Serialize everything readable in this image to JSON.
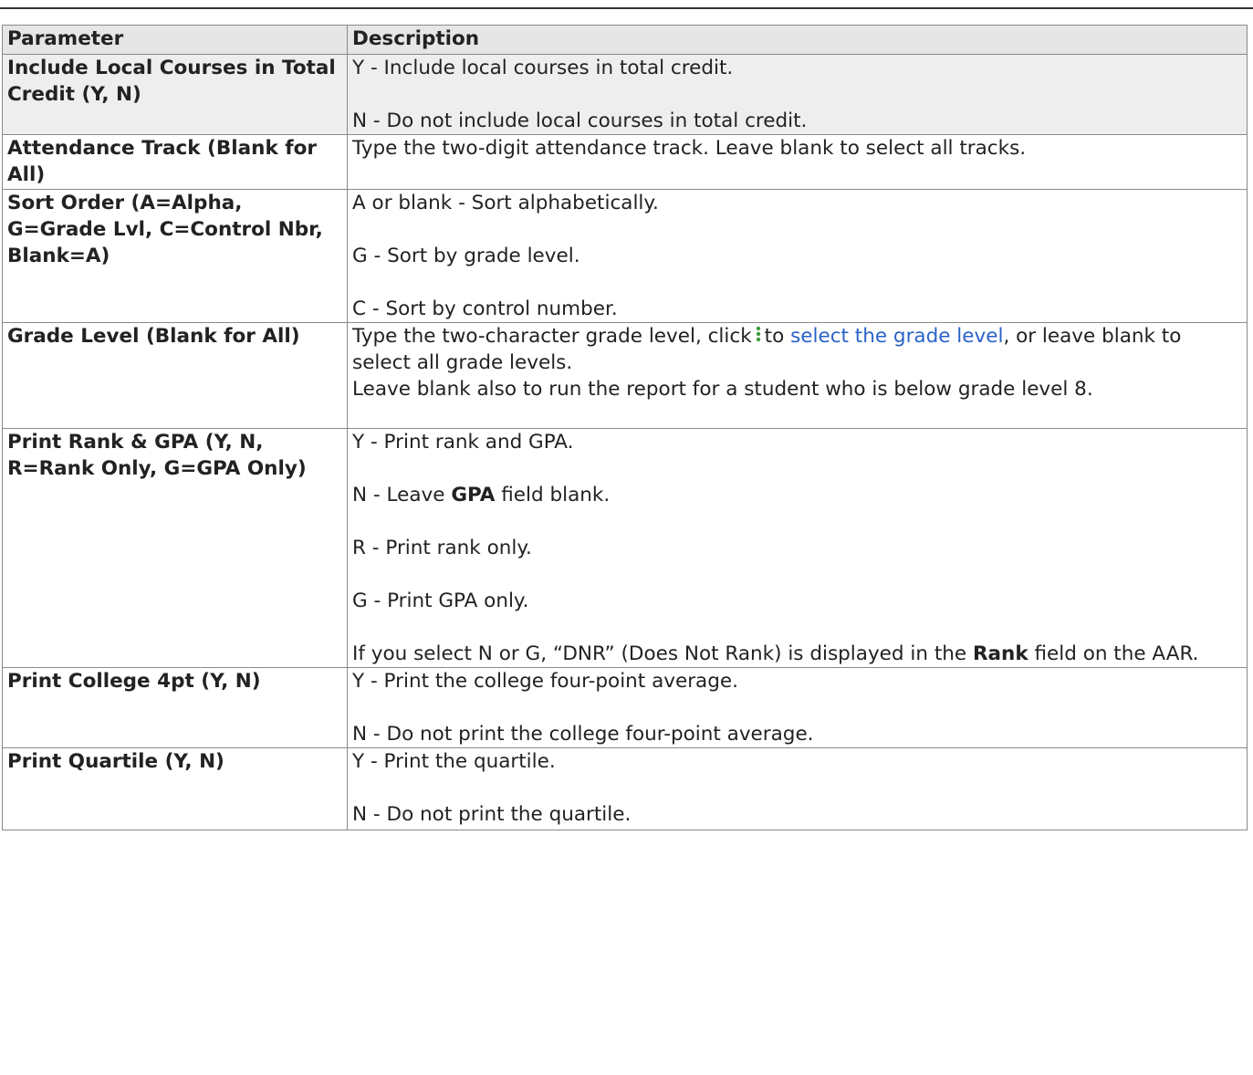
{
  "table": {
    "headers": {
      "parameter": "Parameter",
      "description": "Description"
    },
    "rows": [
      {
        "parameter": "Include Local Courses in Total Credit (Y, N)",
        "lines": [
          "Y - Include local courses in total credit.",
          "N - Do not include local courses in total credit."
        ]
      },
      {
        "parameter": "Attendance Track (Blank for All)",
        "lines": [
          "Type the two-digit attendance track. Leave blank to select all tracks."
        ]
      },
      {
        "parameter": "Sort Order (A=Alpha, G=Grade Lvl, C=Control Nbr, Blank=A)",
        "lines": [
          "A or blank - Sort alphabetically.",
          "G - Sort by grade level.",
          "C - Sort by control number."
        ]
      },
      {
        "parameter": "Grade Level (Blank for All)",
        "desc_prefix": "Type the two-character grade level, click",
        "icon": "vertical-dots-icon",
        "desc_to": "to",
        "link_text": "select the grade level",
        "desc_suffix": ", or leave blank to select all grade levels.",
        "desc_line2": "Leave blank also to run the report for a student who is below grade level 8."
      },
      {
        "parameter": "Print Rank & GPA (Y, N, R=Rank Only, G=GPA Only)",
        "line1": "Y - Print rank and GPA.",
        "line2_pre": "N - Leave",
        "line2_bold": "GPA",
        "line2_post": "field blank.",
        "line3": "R - Print rank only.",
        "line4": "G - Print GPA only.",
        "line5_pre": "If you select N or G, “DNR” (Does Not Rank) is displayed in the",
        "line5_bold": "Rank",
        "line5_post": "field on the AAR."
      },
      {
        "parameter": "Print College 4pt (Y, N)",
        "lines": [
          "Y - Print the college four-point average.",
          "N - Do not print the college four-point average."
        ]
      },
      {
        "parameter": "Print Quartile (Y, N)",
        "lines": [
          "Y - Print the quartile.",
          "N - Do not print the quartile."
        ]
      }
    ]
  },
  "colors": {
    "link": "#2962c8",
    "header_bg": "#e6e6e6",
    "shaded_bg": "#eeeeee",
    "icon": "#3a9d3a"
  }
}
